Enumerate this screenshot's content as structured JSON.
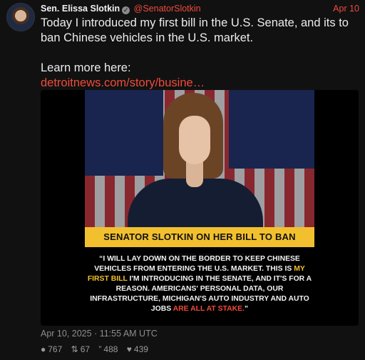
{
  "post": {
    "author_name": "Sen. Elissa Slotkin",
    "verified_symbol": "✓",
    "handle": "@SenatorSlotkin",
    "date": "Apr 10",
    "text_line1": "Today I introduced my first bill in the U.S. Senate, and its to ban Chinese vehicles in the U.S. market.",
    "text_line2": "Learn more here:",
    "link_text": "detroitnews.com/story/busine…",
    "timestamp": "Apr 10, 2025 · 11:55 AM UTC"
  },
  "media": {
    "banner": "SENATOR SLOTKIN ON HER BILL TO BAN CHINESE VEHICLES",
    "quote_part1": "“I will lay down on the border to keep Chinese vehicles from entering the U.S. market. This is ",
    "quote_highlight1": "my first bill",
    "quote_part2": " I'm introducing in the Senate, and it's for a reason. Americans' personal data, our infrastructure, Michigan's auto industry and auto jobs ",
    "quote_highlight2": "are all at stake.",
    "quote_end": "”",
    "highlight_color": "#f2c02e",
    "alert_color": "#f04b3a"
  },
  "stats": {
    "comments": {
      "icon": "comment-icon",
      "value": "767"
    },
    "retweets": {
      "icon": "retweet-icon",
      "value": "67"
    },
    "quotes": {
      "icon": "quote-icon",
      "value": "488"
    },
    "likes": {
      "icon": "heart-icon",
      "value": "439"
    }
  },
  "colors": {
    "accent": "#f04b3a",
    "background": "#111111"
  }
}
